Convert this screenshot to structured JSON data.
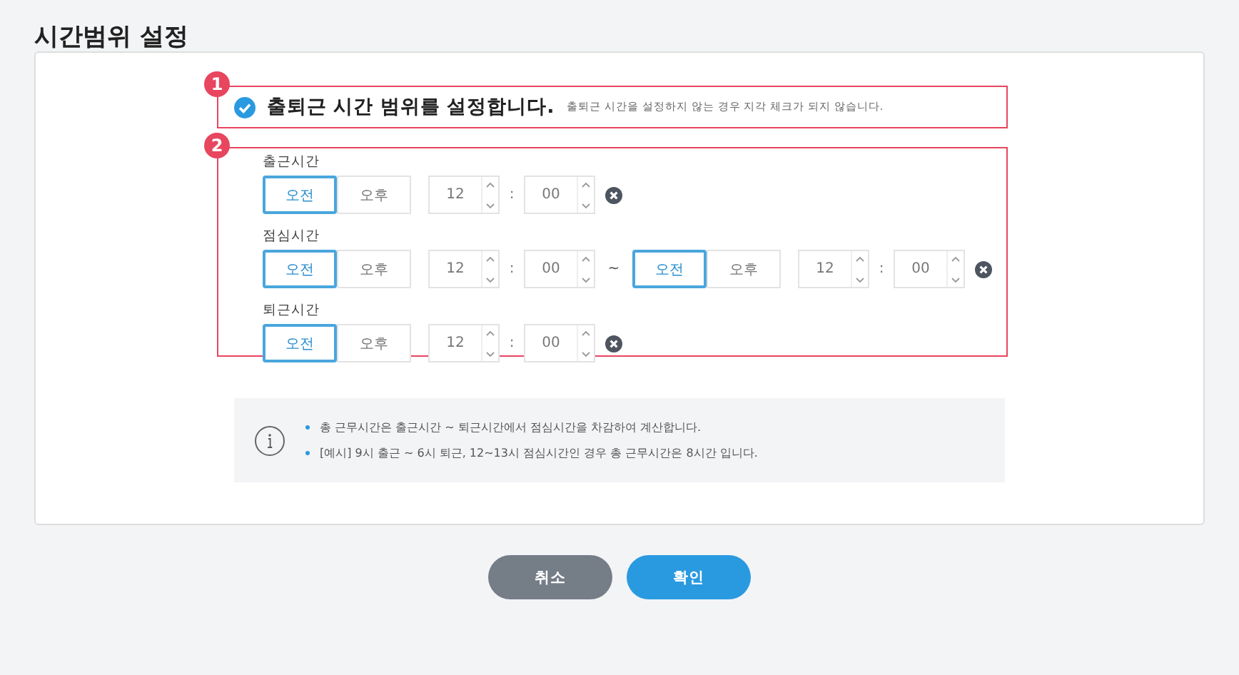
{
  "title": "시간범위 설정",
  "setting": {
    "badge": "1",
    "checked": true,
    "label": "출퇴근 시간 범위를 설정합니다.",
    "hint": "출퇴근 시간을 설정하지 않는 경우 지각 체크가 되지 않습니다."
  },
  "times": {
    "badge": "2",
    "rows": [
      {
        "label": "출근시간",
        "ranges": [
          {
            "periods": [
              {
                "label": "오전",
                "selected": true
              },
              {
                "label": "오후",
                "selected": false
              }
            ],
            "hour": "12",
            "colon": ":",
            "minute": "00"
          }
        ]
      },
      {
        "label": "점심시간",
        "separator": "~",
        "ranges": [
          {
            "periods": [
              {
                "label": "오전",
                "selected": true
              },
              {
                "label": "오후",
                "selected": false
              }
            ],
            "hour": "12",
            "colon": ":",
            "minute": "00"
          },
          {
            "periods": [
              {
                "label": "오전",
                "selected": true
              },
              {
                "label": "오후",
                "selected": false
              }
            ],
            "hour": "12",
            "colon": ":",
            "minute": "00"
          }
        ]
      },
      {
        "label": "퇴근시간",
        "ranges": [
          {
            "periods": [
              {
                "label": "오전",
                "selected": true
              },
              {
                "label": "오후",
                "selected": false
              }
            ],
            "hour": "12",
            "colon": ":",
            "minute": "00"
          }
        ]
      }
    ]
  },
  "notes": [
    "총 근무시간은 출근시간 ~ 퇴근시간에서 점심시간을 차감하여 계산합니다.",
    "[예시] 9시 출근 ~ 6시 퇴근, 12~13시 점심시간인 경우 총 근무시간은 8시간 입니다."
  ],
  "buttons": [
    {
      "kind": "cancel",
      "label": "취소"
    },
    {
      "kind": "confirm",
      "label": "확인"
    }
  ]
}
